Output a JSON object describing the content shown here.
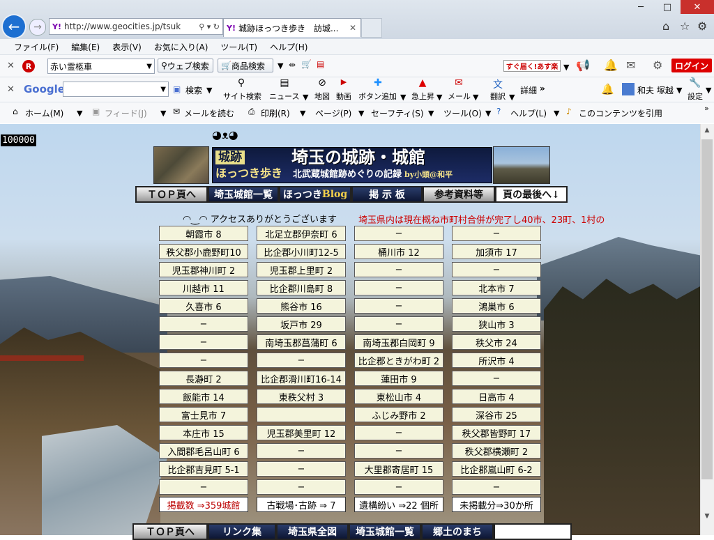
{
  "browser": {
    "url": "http://www.geocities.jp/tsuk",
    "tab_title": "城跡ほっつき歩き　訪城...",
    "favicon_text": "Y!",
    "window_controls": {
      "minimize": "─",
      "maximize": "□",
      "close": "✕"
    }
  },
  "menubar": [
    "ファイル(F)",
    "編集(E)",
    "表示(V)",
    "お気に入り(A)",
    "ツール(T)",
    "ヘルプ(H)"
  ],
  "toolbar1": {
    "search_value": "赤い霊柩車",
    "web_search": "ウェブ検索",
    "product_search": "商品検索",
    "promo": "すぐ届く!あす楽",
    "login": "ログイン"
  },
  "toolbar2": {
    "google": "Google",
    "search": "検索",
    "site_search": "サイト検索",
    "news": "ニュース",
    "map": "地図",
    "video": "動画",
    "add_button": "ボタン追加",
    "rising": "急上昇",
    "mail": "メール",
    "translate": "翻訳",
    "details": "詳細",
    "user": "和夫 塚越",
    "settings": "設定"
  },
  "toolbar3": {
    "home": "ホーム(M)",
    "feed": "フィード(J)",
    "read_mail": "メールを読む",
    "print": "印刷(R)",
    "page": "ページ(P)",
    "safety": "セーフティ(S)",
    "tools": "ツール(O)",
    "help": "ヘルプ(L)",
    "cite": "このコンテンツを引用"
  },
  "page": {
    "counter": "100000",
    "banner": {
      "tag1": "城跡",
      "tag2": "ほっつき歩き",
      "title": "埼玉の城跡・城館",
      "subtitle": "北武蔵城館跡めぐりの記録",
      "by": "by小頭@和平"
    },
    "nav": [
      {
        "label": "ＴＯＰ頁へ"
      },
      {
        "label": "埼玉城館一覧"
      },
      {
        "label_a": "ほっつき",
        "label_b": "Blog"
      },
      {
        "label": "掲 示 板"
      },
      {
        "label": "参考資料等"
      },
      {
        "label": "頁の最後へ↓"
      }
    ],
    "greeting": "アクセスありがとうございます",
    "merger_notice": "埼玉県内は現在概ね市町村合併が完了し40市、23町、1村の",
    "grid_columns": [
      [
        "朝霞市  8",
        "秩父郡小鹿野町10",
        "児玉郡神川町 2",
        "川越市  11",
        "久喜市  6",
        "−",
        "−",
        "−",
        "長瀞町  2",
        "飯能市  14",
        "富士見市  7",
        "本庄市  15",
        "入間郡毛呂山町  6",
        "比企郡吉見町  5-1",
        "−"
      ],
      [
        "北足立郡伊奈町  6",
        "比企郡小川町12-5",
        "児玉郡上里町  2",
        "比企郡川島町  8",
        "熊谷市  16",
        "坂戸市  29",
        "南埼玉郡菖蒲町  6",
        "−",
        "比企郡滑川町16-14",
        "東秩父村  3",
        "",
        "児玉郡美里町  12",
        "−",
        "−",
        "−"
      ],
      [
        "−",
        "桶川市  12",
        "−",
        "−",
        "−",
        "−",
        "南埼玉郡白岡町 9",
        "比企郡ときがわ町 2",
        "蓮田市  9",
        "東松山市  4",
        "ふじみ野市  2",
        "−",
        "−",
        "大里郡寄居町  15",
        "−"
      ],
      [
        "−",
        "加須市  17",
        "−",
        "北本市  7",
        "鴻巣市  6",
        "狭山市 3",
        "秩父市 24",
        "所沢市  4",
        "−",
        "日高市  4",
        "深谷市  25",
        "秩父郡皆野町 17",
        "秩父郡横瀬町 2",
        "比企郡嵐山町  6-2",
        "−"
      ]
    ],
    "footer_stats": [
      "掲載数  ⇒359城館",
      "古戦場･古跡  ⇒  7",
      "遺構紛い  ⇒22 個所",
      "未掲載分⇒30か所"
    ],
    "bottom_nav": [
      "ＴＯＰ頁へ",
      "リンク集",
      "埼玉県全図",
      "埼玉城館一覧",
      "郷土のまち"
    ]
  },
  "colors": {
    "accent_back": "#1d6fd1",
    "login_red": "#dd0000",
    "cell_bg": "#f4f4dc",
    "merger_red": "#cc0000",
    "banner_navy": "#0e1a3d"
  }
}
